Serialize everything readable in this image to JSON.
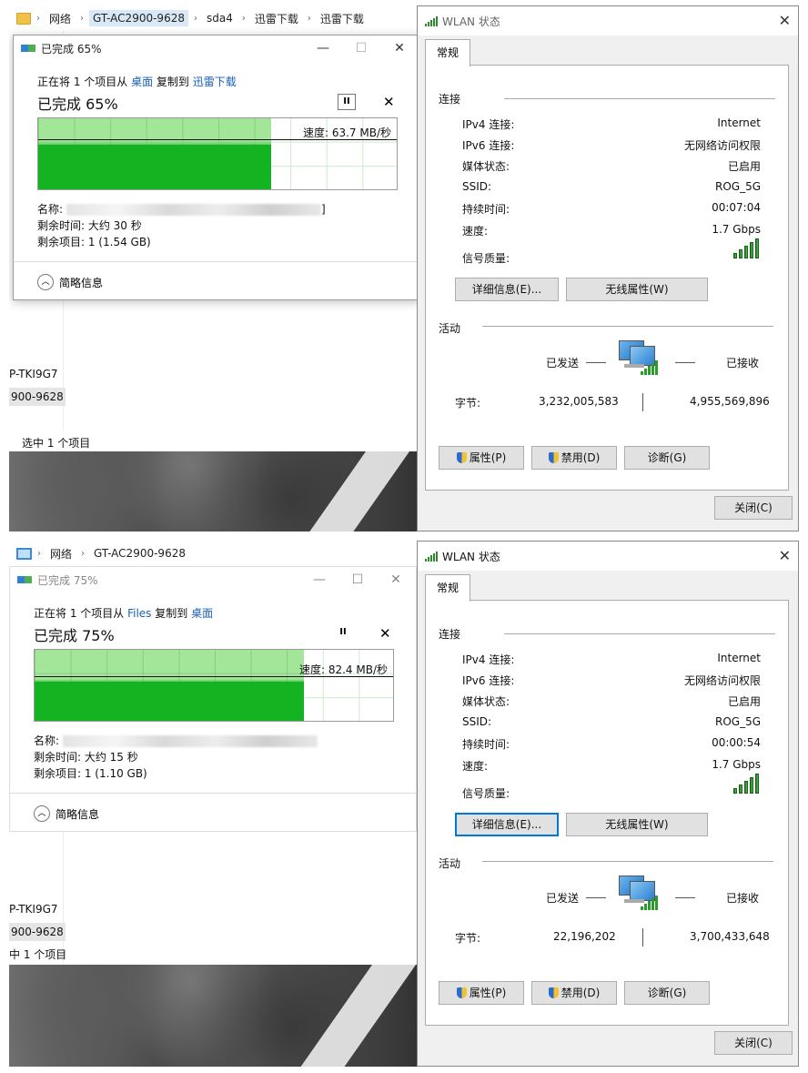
{
  "top": {
    "explorer": {
      "breadcrumb": [
        "网络",
        "GT-AC2900-9628",
        "sda4",
        "迅雷下载",
        "迅雷下载"
      ],
      "nav_items": [
        "P-TKI9G7",
        "900-9628"
      ],
      "status": "选中 1 个项目"
    },
    "copy": {
      "title": "已完成 65%",
      "line_prefix": "正在将 1 个项目从 ",
      "from": "桌面",
      "line_mid": " 复制到 ",
      "to": "迅雷下载",
      "percent_text": "已完成 65%",
      "progress": 0.65,
      "speed_label": "速度: 63.7 MB/秒",
      "speed_level": 0.63,
      "name_label": "名称:",
      "name_tail": "]",
      "time_left": "剩余时间: 大约 30 秒",
      "items_left": "剩余项目: 1 (1.54 GB)",
      "less_details": "简略信息",
      "pause": "II",
      "close": "✕"
    },
    "wlan": {
      "title": "WLAN 状态",
      "tab": "常规",
      "connection_label": "连接",
      "rows": [
        {
          "k": "IPv4 连接:",
          "v": "Internet"
        },
        {
          "k": "IPv6 连接:",
          "v": "无网络访问权限"
        },
        {
          "k": "媒体状态:",
          "v": "已启用"
        },
        {
          "k": "SSID:",
          "v": "ROG_5G"
        },
        {
          "k": "持续时间:",
          "v": "00:07:04"
        },
        {
          "k": "速度:",
          "v": "1.7 Gbps"
        }
      ],
      "signal_label": "信号质量:",
      "details_btn": "详细信息(E)...",
      "wireless_btn": "无线属性(W)",
      "activity_label": "活动",
      "sent_label": "已发送",
      "recv_label": "已接收",
      "bytes_label": "字节:",
      "bytes_sent": "3,232,005,583",
      "bytes_recv": "4,955,569,896",
      "props_btn": "属性(P)",
      "disable_btn": "禁用(D)",
      "diag_btn": "诊断(G)",
      "close_btn": "关闭(C)"
    }
  },
  "bottom": {
    "explorer": {
      "breadcrumb": [
        "网络",
        "GT-AC2900-9628"
      ],
      "nav_items": [
        "P-TKI9G7",
        "900-9628"
      ],
      "status": "中 1 个项目"
    },
    "copy": {
      "title": "已完成 75%",
      "line_prefix": "正在将 1 个项目从 ",
      "from": "Files",
      "line_mid": " 复制到 ",
      "to": "桌面",
      "percent_text": "已完成 75%",
      "progress": 0.75,
      "speed_label": "速度: 82.4 MB/秒",
      "speed_level": 0.55,
      "name_label": "名称:",
      "name_tail": "",
      "time_left": "剩余时间: 大约 15 秒",
      "items_left": "剩余项目: 1 (1.10 GB)",
      "less_details": "简略信息",
      "pause": "II",
      "close": "✕"
    },
    "wlan": {
      "title": "WLAN 状态",
      "tab": "常规",
      "connection_label": "连接",
      "rows": [
        {
          "k": "IPv4 连接:",
          "v": "Internet"
        },
        {
          "k": "IPv6 连接:",
          "v": "无网络访问权限"
        },
        {
          "k": "媒体状态:",
          "v": "已启用"
        },
        {
          "k": "SSID:",
          "v": "ROG_5G"
        },
        {
          "k": "持续时间:",
          "v": "00:00:54"
        },
        {
          "k": "速度:",
          "v": "1.7 Gbps"
        }
      ],
      "signal_label": "信号质量:",
      "details_btn": "详细信息(E)...",
      "wireless_btn": "无线属性(W)",
      "activity_label": "活动",
      "sent_label": "已发送",
      "recv_label": "已接收",
      "bytes_label": "字节:",
      "bytes_sent": "22,196,202",
      "bytes_recv": "3,700,433,648",
      "props_btn": "属性(P)",
      "disable_btn": "禁用(D)",
      "diag_btn": "诊断(G)",
      "close_btn": "关闭(C)"
    }
  },
  "icons": {
    "folder": "folder-icon",
    "computer": "computer-icon",
    "copy": "copy-progress-icon",
    "signal": "wifi-signal-icon",
    "network": "network-computers-icon",
    "shield": "uac-shield-icon"
  },
  "colors": {
    "progress_fill": "#a3e599",
    "speed_fill": "#13b321",
    "link": "#1a5fb4",
    "focus": "#0078d7"
  }
}
